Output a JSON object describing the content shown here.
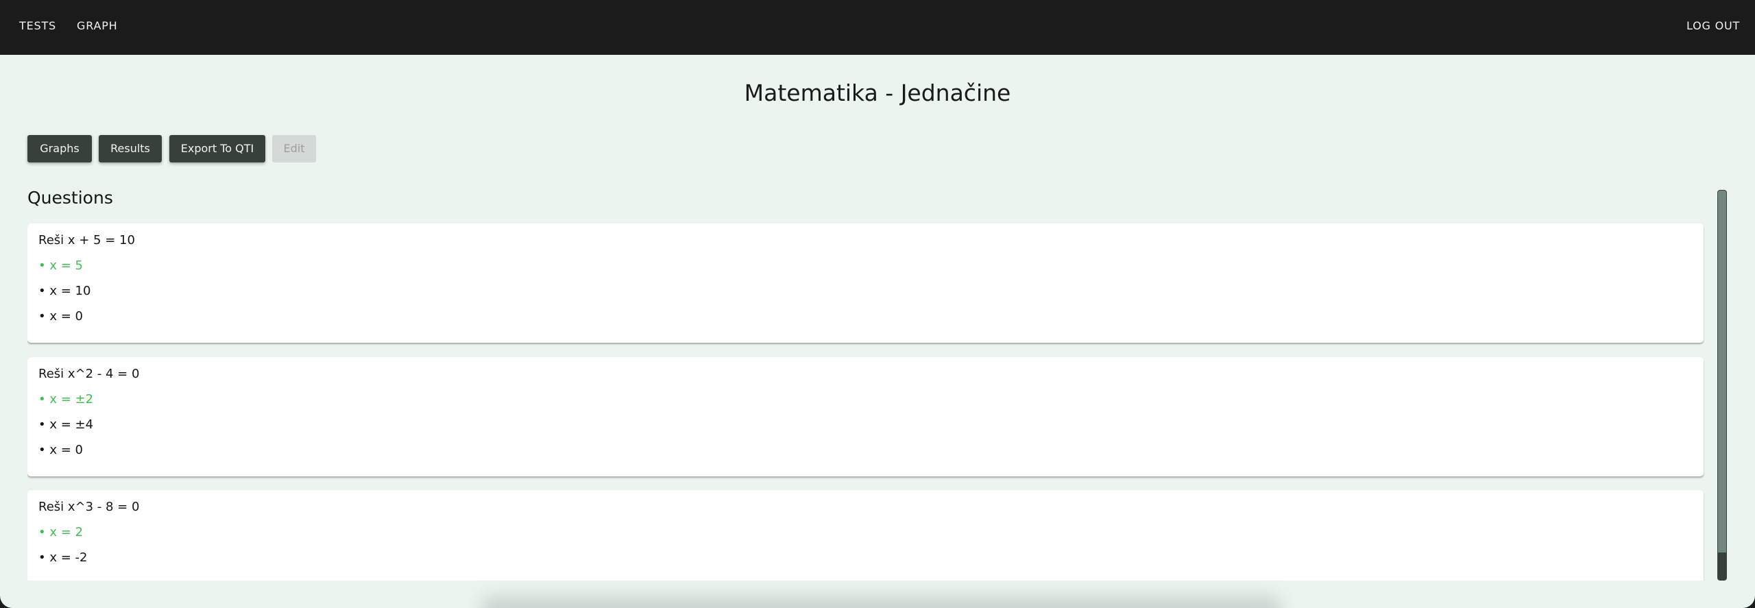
{
  "nav": {
    "items": [
      "TESTS",
      "GRAPH"
    ],
    "logout": "LOG OUT"
  },
  "page": {
    "title": "Matematika - Jednačine"
  },
  "toolbar": {
    "graphs": "Graphs",
    "results": "Results",
    "export": "Export To QTI",
    "edit": "Edit"
  },
  "questions_heading": "Questions",
  "colors": {
    "correct": "#3dc14f",
    "button": "#37403a",
    "background": "#ecf4ef",
    "navbar": "#1b1b1b"
  },
  "questions": [
    {
      "text": "Reši x + 5 = 10",
      "answers": [
        "• x = 5",
        "• x = 10",
        "• x = 0"
      ],
      "correct_index": 0
    },
    {
      "text": "Reši x^2 - 4 = 0",
      "answers": [
        "• x = ±2",
        "• x = ±4",
        "• x = 0"
      ],
      "correct_index": 0
    },
    {
      "text": "Reši x^3 - 8 = 0",
      "answers": [
        "• x = 2",
        "• x = -2"
      ],
      "correct_index": 0
    }
  ]
}
